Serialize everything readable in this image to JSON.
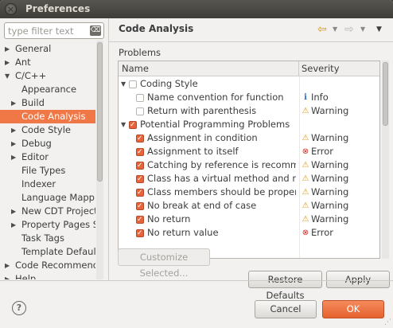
{
  "window": {
    "title": "Preferences",
    "close_glyph": "×"
  },
  "filter": {
    "placeholder": "type filter text",
    "clear_glyph": "⌫"
  },
  "tree": [
    {
      "label": "General",
      "indent": 0,
      "arrow": "▶"
    },
    {
      "label": "Ant",
      "indent": 0,
      "arrow": "▶"
    },
    {
      "label": "C/C++",
      "indent": 0,
      "arrow": "▼"
    },
    {
      "label": "Appearance",
      "indent": 1,
      "arrow": ""
    },
    {
      "label": "Build",
      "indent": 1,
      "arrow": "▶"
    },
    {
      "label": "Code Analysis",
      "indent": 1,
      "arrow": "",
      "selected": true
    },
    {
      "label": "Code Style",
      "indent": 1,
      "arrow": "▶"
    },
    {
      "label": "Debug",
      "indent": 1,
      "arrow": "▶"
    },
    {
      "label": "Editor",
      "indent": 1,
      "arrow": "▶"
    },
    {
      "label": "File Types",
      "indent": 1,
      "arrow": ""
    },
    {
      "label": "Indexer",
      "indent": 1,
      "arrow": ""
    },
    {
      "label": "Language Mappings",
      "indent": 1,
      "arrow": ""
    },
    {
      "label": "New CDT Project Wizard",
      "indent": 1,
      "arrow": "▶"
    },
    {
      "label": "Property Pages Settings",
      "indent": 1,
      "arrow": "▶"
    },
    {
      "label": "Task Tags",
      "indent": 1,
      "arrow": ""
    },
    {
      "label": "Template Default Values",
      "indent": 1,
      "arrow": ""
    },
    {
      "label": "Code Recommenders",
      "indent": 0,
      "arrow": "▶"
    },
    {
      "label": "Help",
      "indent": 0,
      "arrow": "▶"
    }
  ],
  "page": {
    "title": "Code Analysis",
    "nav_back_glyph": "⇦",
    "nav_forward_glyph": "⇨",
    "dropdown_glyph": "▼",
    "problems_label": "Problems"
  },
  "table": {
    "columns": [
      "Name",
      "Severity"
    ],
    "rows": [
      {
        "name": "Coding Style",
        "level": 0,
        "expander": "▼",
        "checked": false,
        "severity": "",
        "icon": ""
      },
      {
        "name": "Name convention for function",
        "level": 1,
        "expander": "",
        "checked": false,
        "severity": "Info",
        "icon": "info"
      },
      {
        "name": "Return with parenthesis",
        "level": 1,
        "expander": "",
        "checked": false,
        "severity": "Warning",
        "icon": "warning"
      },
      {
        "name": "Potential Programming Problems",
        "level": 0,
        "expander": "▼",
        "checked": true,
        "severity": "",
        "icon": ""
      },
      {
        "name": "Assignment in condition",
        "level": 1,
        "expander": "",
        "checked": true,
        "severity": "Warning",
        "icon": "warning"
      },
      {
        "name": "Assignment to itself",
        "level": 1,
        "expander": "",
        "checked": true,
        "severity": "Error",
        "icon": "error"
      },
      {
        "name": "Catching by reference is recommended",
        "level": 1,
        "expander": "",
        "checked": true,
        "severity": "Warning",
        "icon": "warning"
      },
      {
        "name": "Class has a virtual method and non-virtual destructor",
        "level": 1,
        "expander": "",
        "checked": true,
        "severity": "Warning",
        "icon": "warning"
      },
      {
        "name": "Class members should be properly initialized",
        "level": 1,
        "expander": "",
        "checked": true,
        "severity": "Warning",
        "icon": "warning"
      },
      {
        "name": "No break at end of case",
        "level": 1,
        "expander": "",
        "checked": true,
        "severity": "Warning",
        "icon": "warning"
      },
      {
        "name": "No return",
        "level": 1,
        "expander": "",
        "checked": true,
        "severity": "Warning",
        "icon": "warning"
      },
      {
        "name": "No return value",
        "level": 1,
        "expander": "",
        "checked": true,
        "severity": "Error",
        "icon": "error"
      }
    ]
  },
  "severity_glyphs": {
    "info": "i",
    "warning": "⚠",
    "error": "⊗"
  },
  "buttons": {
    "customize": "Customize Selected...",
    "restore_defaults": "Restore Defaults",
    "apply": "Apply",
    "cancel": "Cancel",
    "ok": "OK"
  },
  "help_glyph": "?",
  "colors": {
    "accent": "#f07746",
    "ok_button": "#e8693a",
    "titlebar": "#4a4944"
  }
}
